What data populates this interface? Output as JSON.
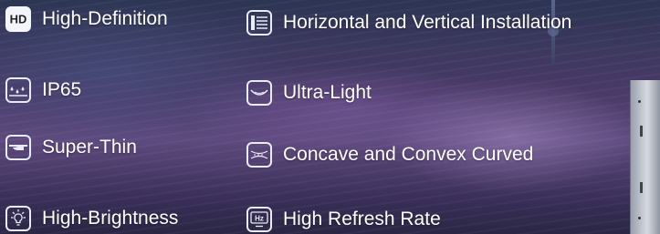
{
  "features": {
    "left": [
      {
        "label": "High-Definition",
        "icon": "hd-icon",
        "icon_text": "HD"
      },
      {
        "label": "IP65",
        "icon": "waterproof-icon"
      },
      {
        "label": "Super-Thin",
        "icon": "thin-hand-icon"
      },
      {
        "label": "High-Brightness",
        "icon": "brightness-icon"
      }
    ],
    "right": [
      {
        "label": "Horizontal and Vertical Installation",
        "icon": "install-panel-icon"
      },
      {
        "label": "Ultra-Light",
        "icon": "feather-icon"
      },
      {
        "label": "Concave and Convex Curved",
        "icon": "curved-icon"
      },
      {
        "label": "High Refresh Rate",
        "icon": "refresh-rate-icon",
        "icon_text": "Hz"
      }
    ]
  },
  "colors": {
    "text": "#ffffff",
    "icon_stroke": "#e8ecf4"
  }
}
